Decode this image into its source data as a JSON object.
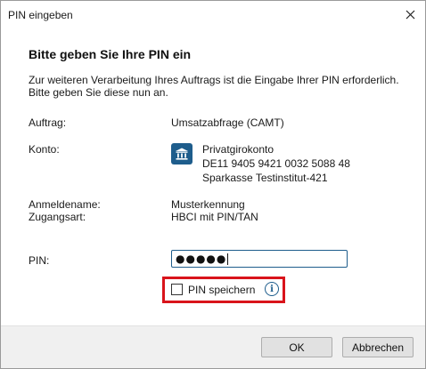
{
  "window": {
    "title": "PIN eingeben",
    "close_icon": "close-icon"
  },
  "content": {
    "heading": "Bitte geben Sie Ihre PIN ein",
    "intro_line1": "Zur weiteren Verarbeitung Ihres Auftrags ist die Eingabe Ihrer PIN erforderlich.",
    "intro_line2": "Bitte geben Sie diese nun an."
  },
  "fields": {
    "auftrag_label": "Auftrag:",
    "auftrag_value": "Umsatzabfrage (CAMT)",
    "konto_label": "Konto:",
    "konto_icon": "bank-icon",
    "konto_name": "Privatgirokonto",
    "konto_iban": "DE11 9405 9421 0032 5088 48",
    "konto_bank": "Sparkasse Testinstitut-421",
    "anmeldename_label": "Anmeldename:",
    "anmeldename_value": "Musterkennung",
    "zugangsart_label": "Zugangsart:",
    "zugangsart_value": "HBCI mit PIN/TAN"
  },
  "pin": {
    "label": "PIN:",
    "masked_value": "●●●●●",
    "save_label": "PIN speichern",
    "save_checked": false,
    "info_icon": "info-icon",
    "highlight_color": "#d9141b"
  },
  "buttons": {
    "ok": "OK",
    "cancel": "Abbrechen"
  },
  "colors": {
    "accent": "#1e5d8c"
  }
}
